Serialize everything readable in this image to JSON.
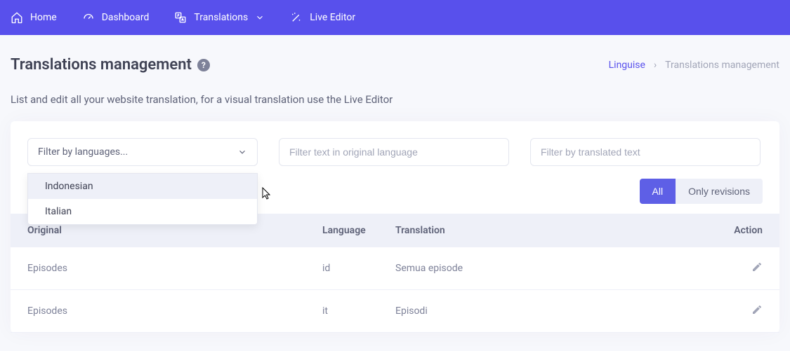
{
  "nav": {
    "items": [
      {
        "label": "Home",
        "icon": "home-icon"
      },
      {
        "label": "Dashboard",
        "icon": "dashboard-icon"
      },
      {
        "label": "Translations",
        "icon": "translate-icon",
        "chevron": true
      },
      {
        "label": "Live Editor",
        "icon": "wand-icon"
      }
    ]
  },
  "header": {
    "title": "Translations management",
    "help": "?"
  },
  "breadcrumb": {
    "home": "Linguise",
    "separator": "›",
    "current": "Translations management"
  },
  "subtitle": "List and edit all your website translation, for a visual translation use the Live Editor",
  "filters": {
    "language_placeholder": "Filter by languages...",
    "original_placeholder": "Filter text in original language",
    "translated_placeholder": "Filter by translated text",
    "dropdown_options": [
      "Indonesian",
      "Italian"
    ]
  },
  "toggle": {
    "all": "All",
    "revisions": "Only revisions"
  },
  "table": {
    "headers": {
      "original": "Original",
      "language": "Language",
      "translation": "Translation",
      "action": "Action"
    },
    "rows": [
      {
        "original": "Episodes",
        "language": "id",
        "translation": "Semua episode"
      },
      {
        "original": "Episodes",
        "language": "it",
        "translation": "Episodi"
      }
    ]
  }
}
